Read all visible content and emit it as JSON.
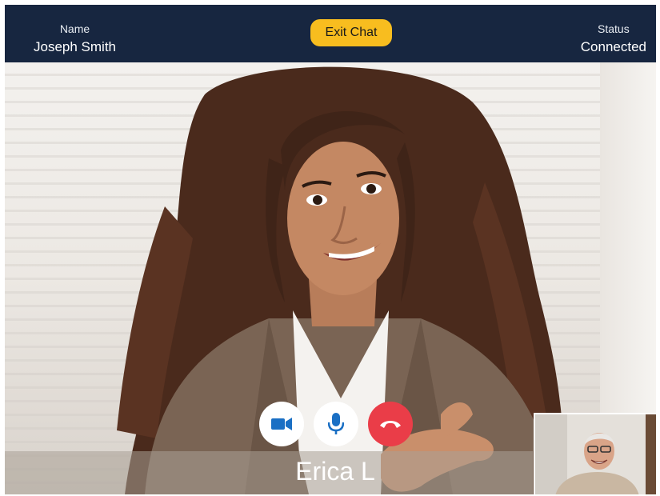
{
  "header": {
    "name_label": "Name",
    "name_value": "Joseph Smith",
    "exit_button": "Exit Chat",
    "status_label": "Status",
    "status_value": "Connected"
  },
  "call": {
    "remote_participant": "Erica L",
    "controls": [
      {
        "id": "video",
        "icon": "video-camera-icon"
      },
      {
        "id": "mic",
        "icon": "microphone-icon"
      },
      {
        "id": "end",
        "icon": "phone-hangup-icon"
      }
    ]
  },
  "colors": {
    "topbar": "#172640",
    "exit_button": "#f8bd1f",
    "end_call": "#ea3d48",
    "control_icon": "#1a6fc4"
  }
}
